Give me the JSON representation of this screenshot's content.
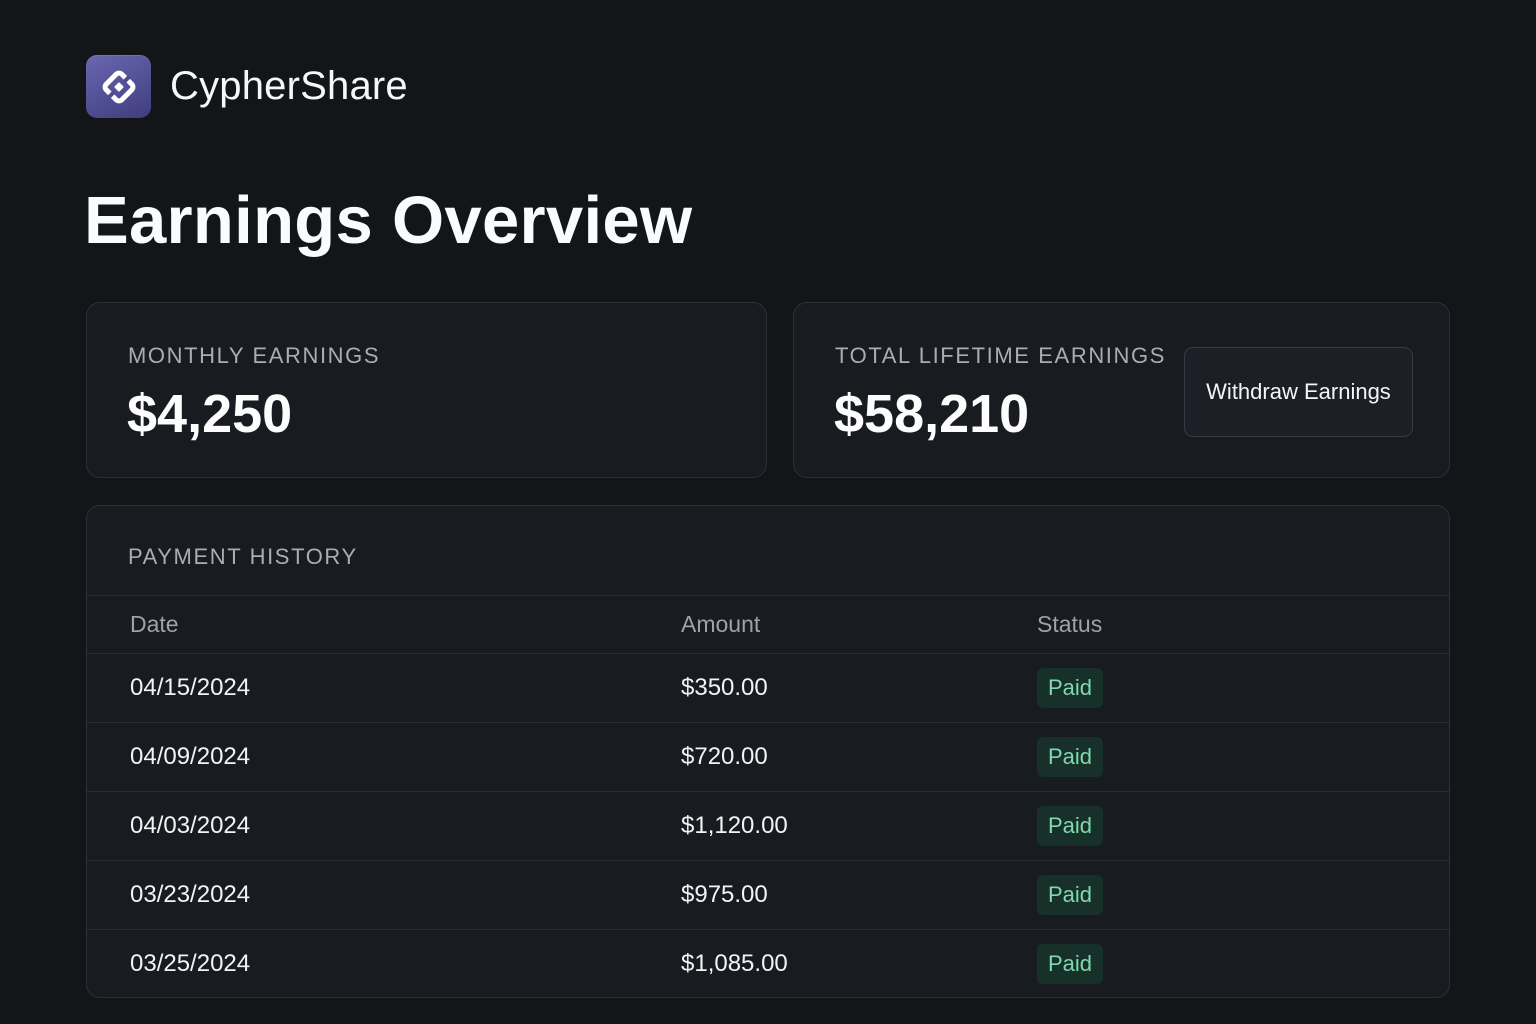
{
  "app": {
    "name": "CypherShare",
    "logo_icon": "diamond-link-icon",
    "accent_color": "#5552a0"
  },
  "page": {
    "title": "Earnings Overview"
  },
  "summary": {
    "monthly": {
      "label": "MONTHLY EARNINGS",
      "value": "$4,250"
    },
    "lifetime": {
      "label": "TOTAL LIFETIME EARNINGS",
      "value": "$58,210",
      "withdraw_label": "Withdraw Earnings"
    }
  },
  "history": {
    "title": "PAYMENT HISTORY",
    "columns": {
      "date": "Date",
      "amount": "Amount",
      "status": "Status"
    },
    "rows": [
      {
        "date": "04/15/2024",
        "amount": "$350.00",
        "status": "Paid"
      },
      {
        "date": "04/09/2024",
        "amount": "$720.00",
        "status": "Paid"
      },
      {
        "date": "04/03/2024",
        "amount": "$1,120.00",
        "status": "Paid"
      },
      {
        "date": "03/23/2024",
        "amount": "$975.00",
        "status": "Paid"
      },
      {
        "date": "03/25/2024",
        "amount": "$1,085.00",
        "status": "Paid"
      }
    ],
    "status_color": "#7fd8ae"
  }
}
